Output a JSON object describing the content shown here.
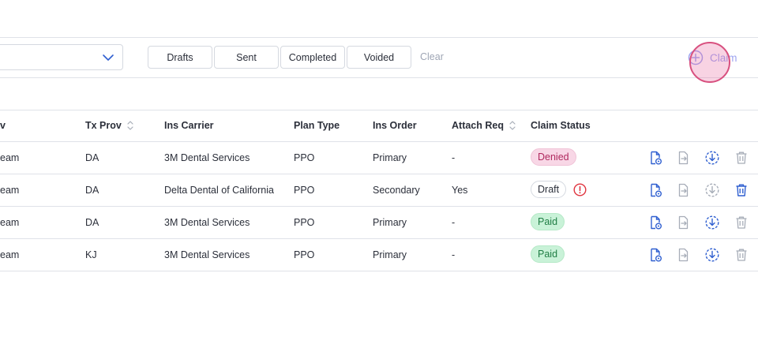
{
  "filters": {
    "dropdown_value": "",
    "buttons": [
      "Drafts",
      "Sent",
      "Completed",
      "Voided"
    ],
    "clear_label": "Clear",
    "add_claim_label": "Claim"
  },
  "table": {
    "headers": [
      "v",
      "Tx Prov",
      "Ins Carrier",
      "Plan Type",
      "Ins Order",
      "Attach Req",
      "Claim Status"
    ],
    "rows": [
      [
        "eam",
        "DA",
        "3M Dental Services",
        "PPO",
        "Primary",
        "-",
        "Denied"
      ],
      [
        "eam",
        "DA",
        "Delta Dental of California",
        "PPO",
        "Secondary",
        "Yes",
        "Draft"
      ],
      [
        "eam",
        "DA",
        "3M Dental Services",
        "PPO",
        "Primary",
        "-",
        "Paid"
      ],
      [
        "eam",
        "KJ",
        "3M Dental Services",
        "PPO",
        "Primary",
        "-",
        "Paid"
      ]
    ]
  },
  "colors": {
    "accent_blue": "#2f5fd0",
    "muted_icon": "#a7adb8",
    "denied_bg": "#f8d7e6",
    "paid_bg": "#c9f2d8",
    "warning_red": "#e0343f",
    "cursor_pink": "#d8507f"
  },
  "icons": [
    "chevron-down-icon",
    "plus-circle-icon",
    "sort-icon",
    "document-view-icon",
    "document-export-icon",
    "download-circle-icon",
    "trash-icon",
    "alert-circle-icon"
  ]
}
